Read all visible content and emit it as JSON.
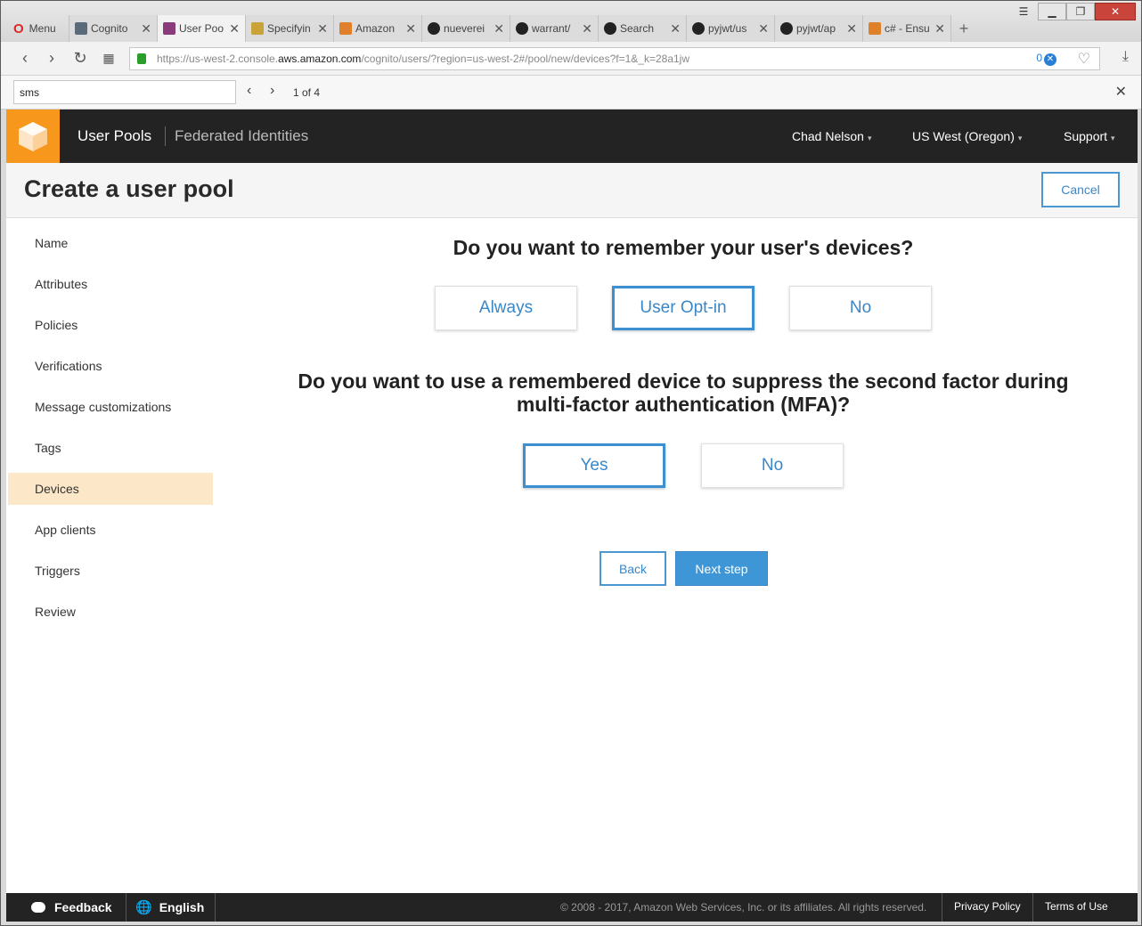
{
  "browser": {
    "menu_label": "Menu",
    "tabs": [
      {
        "label": "Cognito",
        "color": "#5a6b7c"
      },
      {
        "label": "User Poo",
        "color": "#8a3b7c"
      },
      {
        "label": "Specifyin",
        "color": "#c9a23a"
      },
      {
        "label": "Amazon",
        "color": "#e0802a"
      },
      {
        "label": "nueverei",
        "color": "#222222"
      },
      {
        "label": "warrant/",
        "color": "#222222"
      },
      {
        "label": "Search",
        "color": "#222222"
      },
      {
        "label": "pyjwt/us",
        "color": "#222222"
      },
      {
        "label": "pyjwt/ap",
        "color": "#222222"
      },
      {
        "label": "c# - Ensu",
        "color": "#e0802a"
      }
    ],
    "url_prefix": "https://us-west-2.console.",
    "url_domain": "aws.amazon.com",
    "url_suffix": "/cognito/users/?region=us-west-2#/pool/new/devices?f=1&_k=28a1jw",
    "adblock_count": "0",
    "find_query": "sms",
    "find_count": "1 of 4"
  },
  "header": {
    "user_pools": "User Pools",
    "federated_identities": "Federated Identities",
    "user": "Chad Nelson",
    "region": "US West (Oregon)",
    "support": "Support"
  },
  "page": {
    "title": "Create a user pool",
    "cancel": "Cancel"
  },
  "sidebar": {
    "items": [
      {
        "label": "Name"
      },
      {
        "label": "Attributes"
      },
      {
        "label": "Policies"
      },
      {
        "label": "Verifications"
      },
      {
        "label": "Message customizations"
      },
      {
        "label": "Tags"
      },
      {
        "label": "Devices"
      },
      {
        "label": "App clients"
      },
      {
        "label": "Triggers"
      },
      {
        "label": "Review"
      }
    ],
    "active_label": "Devices"
  },
  "main": {
    "q1": "Do you want to remember your user's devices?",
    "q1_options": [
      "Always",
      "User Opt-in",
      "No"
    ],
    "q1_selected": "User Opt-in",
    "q2_line1": "Do you want to use a remembered device to suppress the second factor during",
    "q2_line2": "multi-factor authentication (MFA)?",
    "q2_options": [
      "Yes",
      "No"
    ],
    "q2_selected": "Yes",
    "back": "Back",
    "next": "Next step"
  },
  "footer": {
    "feedback": "Feedback",
    "language": "English",
    "copyright": "© 2008 - 2017, Amazon Web Services, Inc. or its affiliates. All rights reserved.",
    "privacy": "Privacy Policy",
    "terms": "Terms of Use"
  }
}
